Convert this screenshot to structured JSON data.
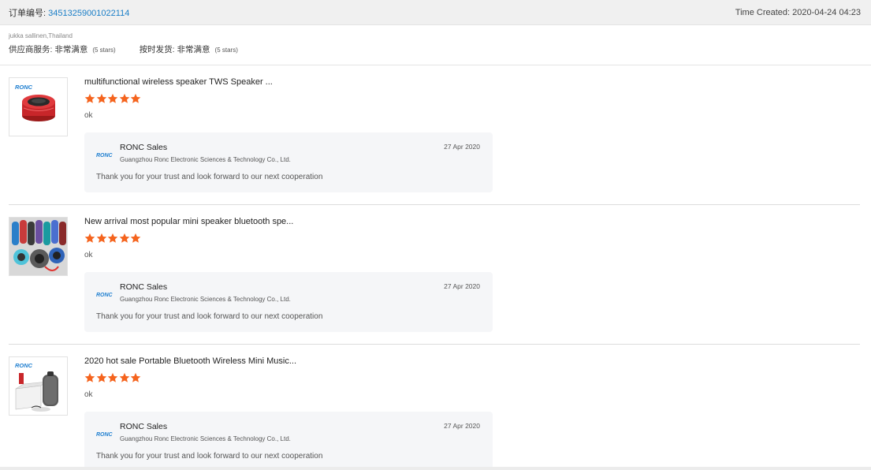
{
  "header": {
    "order_label": "订单编号: ",
    "order_number": "34513259001022114",
    "time_created": "Time Created: 2020-04-24 04:23"
  },
  "buyer": {
    "name_location": "jukka sallinen,Thailand",
    "ratings": [
      {
        "label": "供应商服务: 非常满意",
        "note": "(5 stars)"
      },
      {
        "label": "按时发货: 非常满意",
        "note": "(5 stars)"
      }
    ]
  },
  "reviews": [
    {
      "product_title": "multifunctional wireless speaker TWS Speaker ...",
      "rating": 5,
      "review_text": "ok",
      "reply": {
        "seller_name": "RONC Sales",
        "company": "Guangzhou Ronc Electronic Sciences & Technology Co., Ltd.",
        "date": "27 Apr 2020",
        "text": "Thank you for your trust and look forward to our next cooperation"
      }
    },
    {
      "product_title": "New arrival most popular mini speaker bluetooth spe...",
      "rating": 5,
      "review_text": "ok",
      "reply": {
        "seller_name": "RONC Sales",
        "company": "Guangzhou Ronc Electronic Sciences & Technology Co., Ltd.",
        "date": "27 Apr 2020",
        "text": "Thank you for your trust and look forward to our next cooperation"
      }
    },
    {
      "product_title": "2020 hot sale Portable Bluetooth Wireless Mini Music...",
      "rating": 5,
      "review_text": "ok",
      "reply": {
        "seller_name": "RONC Sales",
        "company": "Guangzhou Ronc Electronic Sciences & Technology Co., Ltd.",
        "date": "27 Apr 2020",
        "text": "Thank you for your trust and look forward to our next cooperation"
      }
    }
  ],
  "brand": {
    "logo_text": "RONC",
    "logo_color": "#1f7fd0",
    "star_color": "#f5641e",
    "link_color": "#1a7ec7"
  }
}
